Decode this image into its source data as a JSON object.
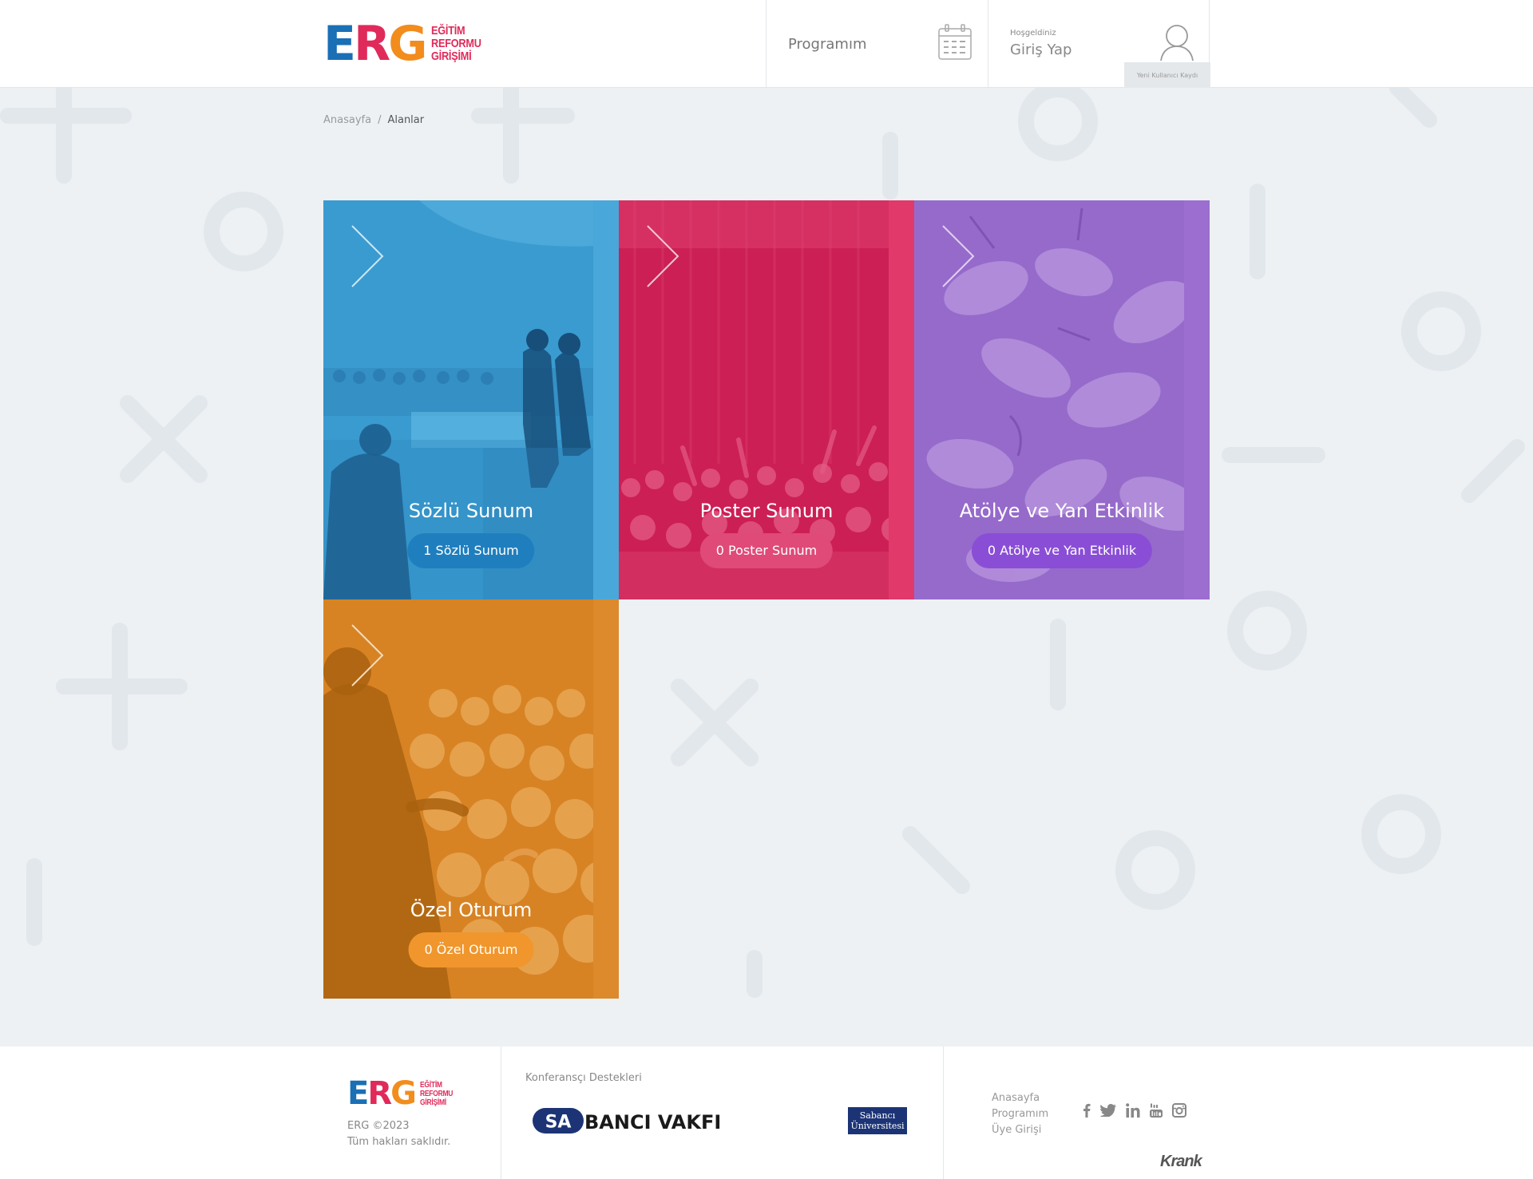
{
  "header": {
    "logo_letters": [
      "E",
      "R",
      "G"
    ],
    "logo_text": [
      "EĞİTİM",
      "REFORMU",
      "GİRİŞİMİ"
    ],
    "program_label": "Programım",
    "welcome_label": "Hoşgeldiniz",
    "login_label": "Giriş Yap",
    "register_label": "Yeni Kullanıcı Kaydı"
  },
  "breadcrumb": {
    "home": "Anasayfa",
    "separator": "/",
    "current": "Alanlar"
  },
  "cards": [
    {
      "title": "Sözlü Sunum",
      "count_label": "1 Sözlü Sunum",
      "color": "#3a9bd0",
      "pill_color": "#1f7fbe"
    },
    {
      "title": "Poster Sunum",
      "count_label": "0 Poster Sunum",
      "color": "#cc1f55",
      "pill_color": "#df4a78"
    },
    {
      "title": "Atölye ve Yan Etkinlik",
      "count_label": "0 Atölye ve Yan Etkinlik",
      "color": "#9062c7",
      "pill_color": "#8a4ed6"
    },
    {
      "title": "Özel Oturum",
      "count_label": "0 Özel Oturum",
      "color": "#d47e1e",
      "pill_color": "#f0962c"
    }
  ],
  "footer": {
    "copyright": "ERG ©2023",
    "rights": "Tüm hakları saklıdır.",
    "sponsors_title": "Konferansçı Destekleri",
    "sponsor_1": "SABANCI VAKFI",
    "sponsor_2_line1": "Sabancı",
    "sponsor_2_line2": "Üniversitesi",
    "links": [
      "Anasayfa",
      "Programım",
      "Üye Girişi"
    ],
    "social_icons": [
      "facebook-icon",
      "twitter-icon",
      "linkedin-icon",
      "youtube-icon",
      "instagram-icon"
    ],
    "agency": "Krank"
  }
}
